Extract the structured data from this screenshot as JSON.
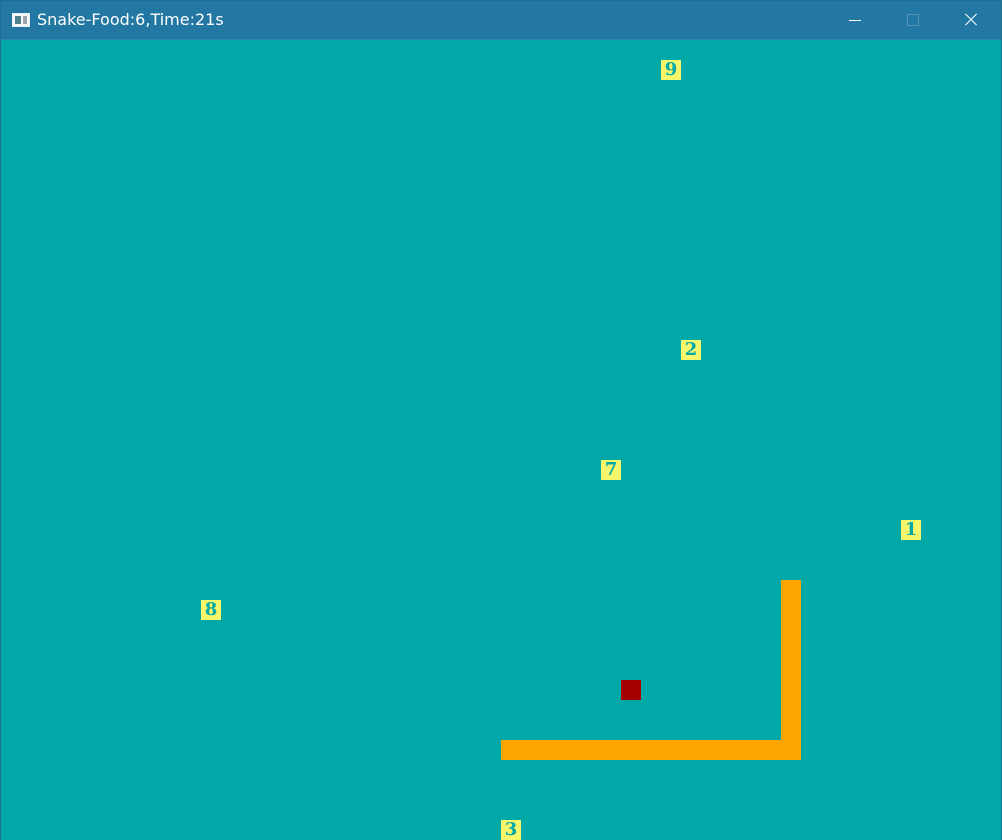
{
  "window": {
    "title": "Snake-Food:6,Time:21s",
    "background": "#00a8a8",
    "titlebar_color": "#2278a2"
  },
  "controls": {
    "minimize_icon": "minimize-icon",
    "maximize_icon": "maximize-icon",
    "close_icon": "close-icon"
  },
  "foods": [
    {
      "label": "9"
    },
    {
      "label": "2"
    },
    {
      "label": "7"
    },
    {
      "label": "1"
    },
    {
      "label": "8"
    },
    {
      "label": "3"
    }
  ],
  "colors": {
    "food": "#f6f66a",
    "food_text": "#00a8a8",
    "snake": "#ffa500",
    "red_block": "#a80000"
  }
}
